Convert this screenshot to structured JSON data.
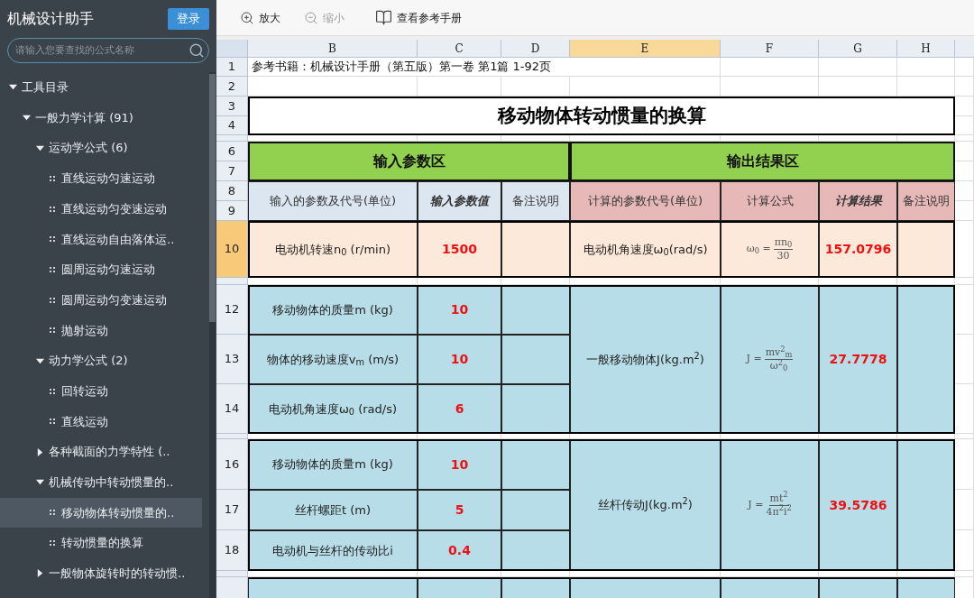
{
  "sidebar": {
    "title": "机械设计助手",
    "login_button": "登录",
    "search": {
      "placeholder": "请输入您要查找的公式名称"
    },
    "tree": [
      {
        "kind": "group",
        "label": "工具目录",
        "expanded": true,
        "children": [
          {
            "kind": "group",
            "label": "一般力学计算 (91)",
            "expanded": true,
            "children": [
              {
                "kind": "group",
                "label": "运动学公式 (6)",
                "expanded": true,
                "children": [
                  {
                    "kind": "formula",
                    "label": "直线运动匀速运动",
                    "selected": false
                  },
                  {
                    "kind": "formula",
                    "label": "直线运动匀变速运动",
                    "selected": false
                  },
                  {
                    "kind": "formula",
                    "label": "直线运动自由落体运..",
                    "selected": false
                  },
                  {
                    "kind": "formula",
                    "label": "圆周运动匀速运动",
                    "selected": false
                  },
                  {
                    "kind": "formula",
                    "label": "圆周运动匀变速运动",
                    "selected": false
                  },
                  {
                    "kind": "formula",
                    "label": "抛射运动",
                    "selected": false
                  }
                ]
              },
              {
                "kind": "group",
                "label": "动力学公式 (2)",
                "expanded": true,
                "children": [
                  {
                    "kind": "formula",
                    "label": "回转运动",
                    "selected": false
                  },
                  {
                    "kind": "formula",
                    "label": "直线运动",
                    "selected": false
                  }
                ]
              },
              {
                "kind": "group",
                "label": "各种截面的力学特性 (..",
                "expanded": false
              },
              {
                "kind": "group",
                "label": "机械传动中转动惯量的..",
                "expanded": true,
                "children": [
                  {
                    "kind": "formula",
                    "label": "移动物体转动惯量的..",
                    "selected": true
                  },
                  {
                    "kind": "formula",
                    "label": "转动惯量的换算",
                    "selected": false
                  }
                ]
              },
              {
                "kind": "group",
                "label": "一般物体旋转时的转动惯..",
                "expanded": false
              }
            ]
          }
        ]
      }
    ]
  },
  "toolbar": [
    {
      "kind": "zoom-in",
      "label": "放大",
      "disabled": false
    },
    {
      "kind": "zoom-out",
      "label": "缩小",
      "disabled": true
    },
    {
      "kind": "manual",
      "label": "查看参考手册",
      "disabled": false
    }
  ],
  "sheet": {
    "columns": [
      {
        "label": "B",
        "selected": false
      },
      {
        "label": "C",
        "selected": false
      },
      {
        "label": "D",
        "selected": false
      },
      {
        "label": "E",
        "selected": true
      },
      {
        "label": "F",
        "selected": false
      },
      {
        "label": "G",
        "selected": false
      },
      {
        "label": "H",
        "selected": false
      }
    ],
    "row_headers": [
      {
        "label": "1",
        "selected": false
      },
      {
        "label": "2",
        "selected": false
      },
      {
        "label": "3",
        "selected": false
      },
      {
        "label": "4",
        "selected": false
      },
      {
        "label": "6",
        "selected": false
      },
      {
        "label": "7",
        "selected": false
      },
      {
        "label": "8",
        "selected": false
      },
      {
        "label": "9",
        "selected": false
      },
      {
        "label": "10",
        "selected": true
      },
      {
        "label": "12",
        "selected": false
      },
      {
        "label": "13",
        "selected": false
      },
      {
        "label": "14",
        "selected": false
      },
      {
        "label": "16",
        "selected": false
      },
      {
        "label": "17",
        "selected": false
      },
      {
        "label": "18",
        "selected": false
      }
    ],
    "reference": "参考书籍：机械设计手册（第五版）第一卷 第1篇  1-92页",
    "title": "移动物体转动惯量的换算",
    "input_header": "输入参数区",
    "output_header": "输出结果区",
    "input_columns": [
      {
        "label": "输入的参数及代号(单位)",
        "emphasis": false
      },
      {
        "label": "输入参数值",
        "emphasis": true
      },
      {
        "label": "备注说明",
        "emphasis": false
      }
    ],
    "output_columns": [
      {
        "label": "计算的参数代号(单位)",
        "emphasis": false
      },
      {
        "label": "计算公式",
        "emphasis": false
      },
      {
        "label": "计算结果",
        "emphasis": true
      },
      {
        "label": "备注说明",
        "emphasis": false
      }
    ],
    "groups": [
      {
        "color": "#fde9d9",
        "inputs": [
          {
            "label": "电动机转速n$_{0}$ (r/min)",
            "value": "1500"
          }
        ],
        "output": {
          "label": "电动机角速度ω$_{0}$(rad/s)",
          "formula": {
            "lhs": "ω$_{0}$ =",
            "numerator": "πn$_{0}$",
            "denominator": "30"
          },
          "result": "157.0796"
        }
      },
      {
        "color": "#b7dde8",
        "inputs": [
          {
            "label": "移动物体的质量m (kg)",
            "value": "10"
          },
          {
            "label": "物体的移动速度v$_{m}$ (m/s)",
            "value": "10"
          },
          {
            "label": "电动机角速度ω$_{0}$ (rad/s)",
            "value": "6"
          }
        ],
        "output": {
          "label": "一般移动物体J(kg.m$^{2}$)",
          "formula": {
            "lhs": "J =",
            "numerator": "mv$^{2}$$_{m}$",
            "denominator": "ω$^{2}$$_{0}$"
          },
          "result": "27.7778"
        }
      },
      {
        "color": "#b7dde8",
        "inputs": [
          {
            "label": "移动物体的质量m (kg)",
            "value": "10"
          },
          {
            "label": "丝杆螺距t (m)",
            "value": "5"
          },
          {
            "label": "电动机与丝杆的传动比i",
            "value": "0.4"
          }
        ],
        "output": {
          "label": "丝杆传动J(kg.m$^{2}$)",
          "formula": {
            "lhs": "J =",
            "numerator": "mt$^{2}$",
            "denominator": "4π$^{2}$i$^{2}$"
          },
          "result": "39.5786"
        }
      }
    ]
  }
}
